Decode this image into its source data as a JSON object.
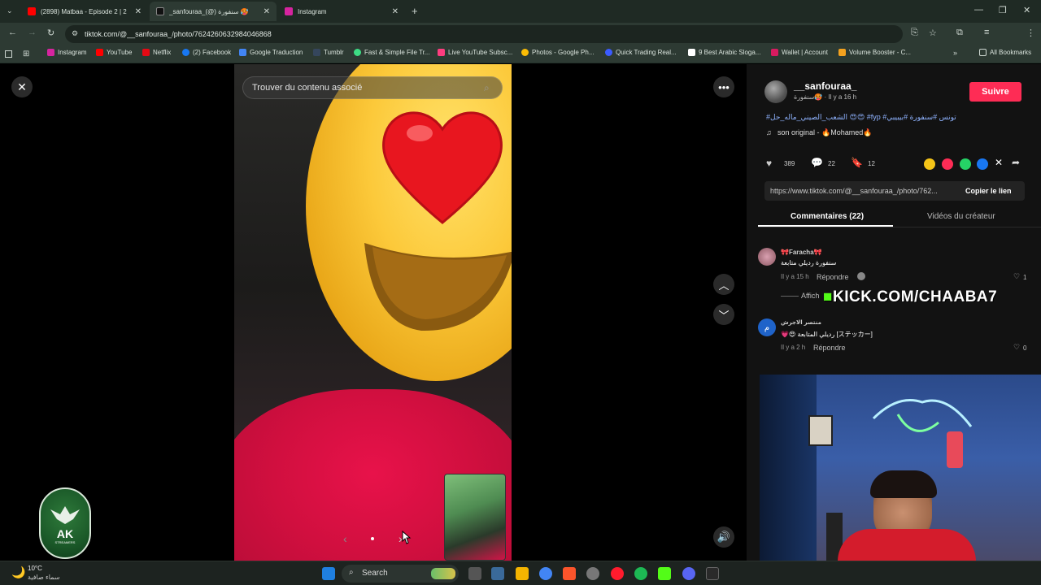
{
  "tabs": [
    {
      "title": "(2898) Matbaa - Episode 2 | 2",
      "favicon_color": "#ff0000"
    },
    {
      "title": "_sanfouraa_(@) سنفورة 🥵",
      "favicon_color": "#111111"
    },
    {
      "title": "Instagram",
      "favicon_color": "#d6249f"
    }
  ],
  "address_bar": {
    "url": "tiktok.com/@__sanfouraa_/photo/7624260632984046868"
  },
  "bookmarks": [
    {
      "label": "Instagram",
      "color": "#d6249f"
    },
    {
      "label": "YouTube",
      "color": "#ff0000"
    },
    {
      "label": "Netflix",
      "color": "#e50914"
    },
    {
      "label": "(2) Facebook",
      "color": "#1877f2"
    },
    {
      "label": "Google Traduction",
      "color": "#4285f4"
    },
    {
      "label": "Tumblr",
      "color": "#35465c"
    },
    {
      "label": "Fast & Simple File Tr...",
      "color": "#3ddc84"
    },
    {
      "label": "Live YouTube Subsc...",
      "color": "#ff3d7f"
    },
    {
      "label": "Photos - Google Ph...",
      "color": "#fbbc05"
    },
    {
      "label": "Quick Trading Real...",
      "color": "#3b5bff"
    },
    {
      "label": "9 Best Arabic Sloga...",
      "color": "#ffffff"
    },
    {
      "label": "Wallet | Account",
      "color": "#d81b60"
    },
    {
      "label": "Volume Booster - C...",
      "color": "#f4a21f"
    }
  ],
  "all_bookmarks_label": "All Bookmarks",
  "viewer": {
    "search_placeholder": "Trouver du contenu associé",
    "watermark": "AK STREAMERS"
  },
  "author": {
    "username": "__sanfouraa_",
    "sub": "سنفورة🥵 · Il y a 16 h",
    "follow_label": "Suivre"
  },
  "caption": "#الشعب_الصيني_ماله_حل 😍😍 #fyp #تونس #سنفورة #بيبيبي",
  "sound": "son original - 🔥Mohamed🔥",
  "stats": {
    "likes": "389",
    "comments": "22",
    "saves": "12"
  },
  "link": {
    "url": "https://www.tiktok.com/@__sanfouraa_/photo/762...",
    "copy_label": "Copier le lien"
  },
  "tabs_panel": {
    "comments_label": "Commentaires (22)",
    "videos_label": "Vidéos du créateur"
  },
  "comments": [
    {
      "author": "🎀Faracha🎀",
      "text": "سنفورة رديلي متابعة",
      "time": "Il y a 15 h",
      "reply": "Répondre",
      "likes": "1",
      "more": "Affich"
    },
    {
      "author": "منتصر الاجرش",
      "text": "💗😍 رديلي المتابعة [ステッカー]",
      "time": "Il y a 2 h",
      "reply": "Répondre",
      "likes": "0"
    }
  ],
  "overlay_text": "KICK.COM/CHAABA7",
  "taskbar": {
    "weather_temp": "10°C",
    "weather_desc": "سماء صافية",
    "search_label": "Search"
  }
}
